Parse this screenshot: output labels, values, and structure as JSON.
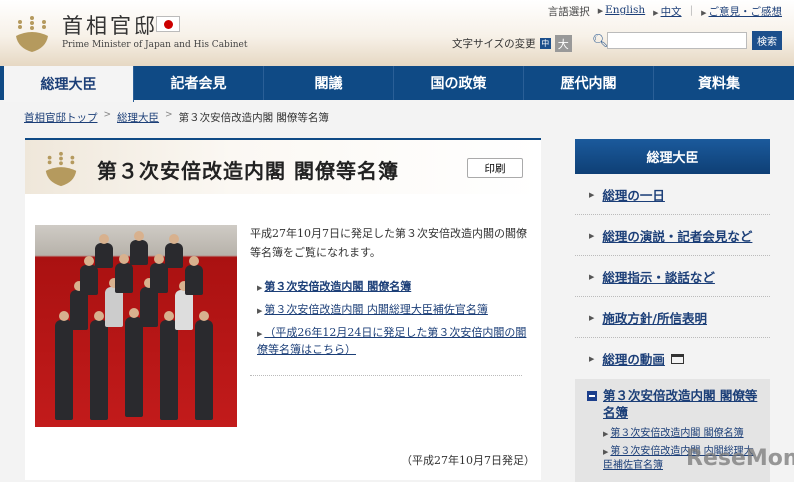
{
  "header": {
    "site_title": "首相官邸",
    "site_subtitle": "Prime Minister of Japan and His Cabinet",
    "language_label": "言語選択",
    "english": "English",
    "chinese": "中文",
    "feedback": "ご意見・ご感想",
    "font_size_label": "文字サイズの変更",
    "font_mid": "中",
    "font_large": "大",
    "search_placeholder": "",
    "search_button": "検索"
  },
  "nav": [
    "総理大臣",
    "記者会見",
    "閣議",
    "国の政策",
    "歴代内閣",
    "資料集"
  ],
  "breadcrumb": {
    "items": [
      "首相官邸トップ",
      "総理大臣"
    ],
    "current": "第３次安倍改造内閣 閣僚等名簿",
    "sep": ">"
  },
  "main": {
    "title": "第３次安倍改造内閣 閣僚等名簿",
    "print": "印刷",
    "intro": "平成27年10月7日に発足した第３次安倍改造内閣の閣僚等名簿をご覧になれます。",
    "links": [
      "第３次安倍改造内閣 閣僚名簿",
      "第３次安倍改造内閣 内閣総理大臣補佐官名簿",
      "（平成26年12月24日に発足した第３次安倍内閣の閣僚等名簿はこちら）"
    ],
    "date": "（平成27年10月7日発足）"
  },
  "sidebar": {
    "heading": "総理大臣",
    "items": [
      "総理の一日",
      "総理の演説・記者会見など",
      "総理指示・談話など",
      "施政方針/所信表明",
      "総理の動画"
    ],
    "active": "第３次安倍改造内閣 閣僚等名簿",
    "sub": [
      "第３次安倍改造内閣 閣僚名簿",
      "第３次安倍改造内閣 内閣総理大臣補佐官名簿"
    ]
  },
  "watermark": "ReseMom"
}
